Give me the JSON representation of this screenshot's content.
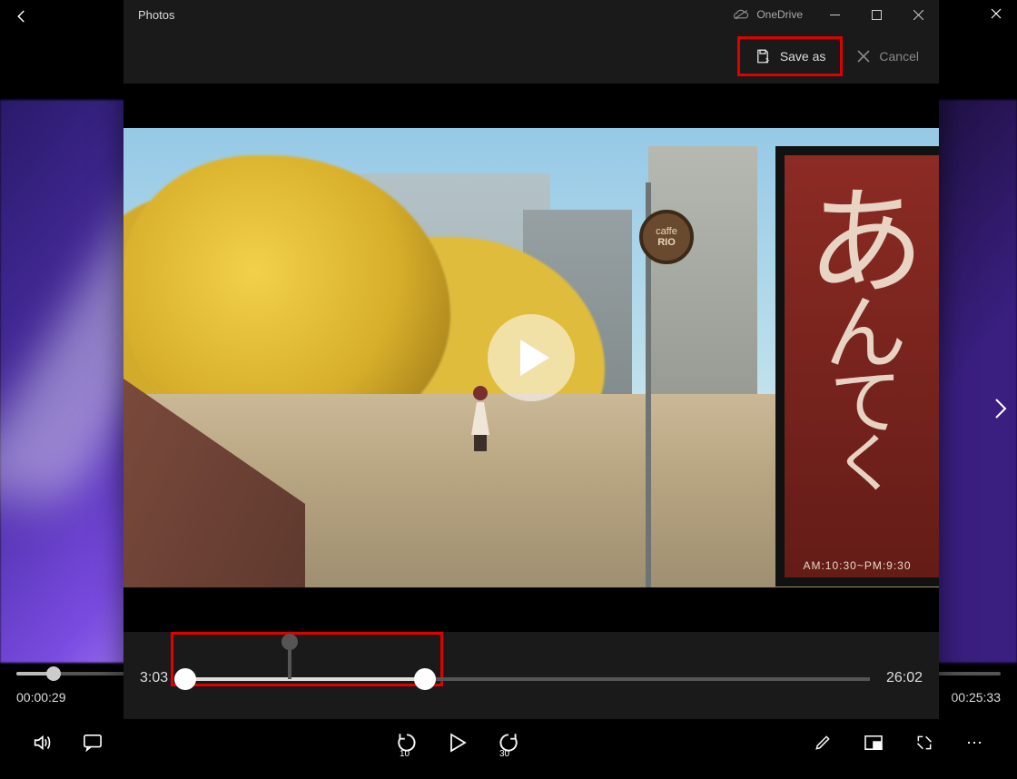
{
  "outer": {
    "time_current": "00:00:29",
    "time_total": "00:25:33"
  },
  "inner": {
    "title": "Photos",
    "onedrive": "OneDrive",
    "save_as": "Save as",
    "cancel": "Cancel",
    "trim_start": "3:03",
    "trim_end": "26:02",
    "cafe_line1": "caffe",
    "cafe_line2": "RIO",
    "sign_hours": "AM:10:30~PM:9:30",
    "skip_back": "10",
    "skip_fwd": "30"
  }
}
